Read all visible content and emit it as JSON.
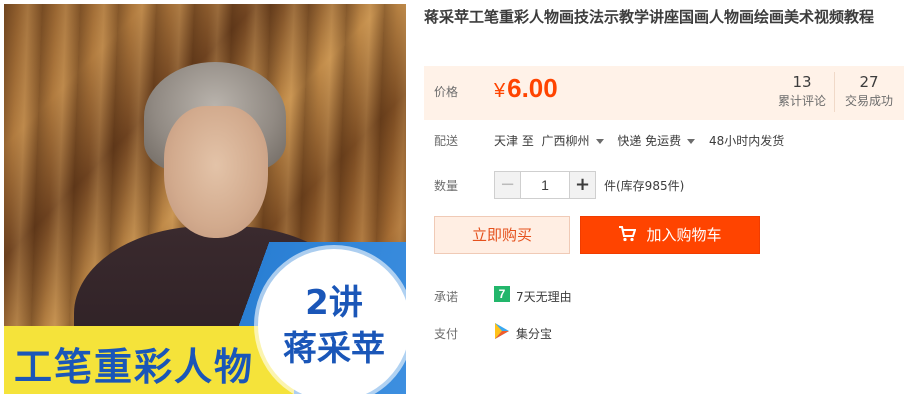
{
  "product": {
    "image": {
      "banner_title": "工笔重彩人物",
      "circle_line1": "2讲",
      "circle_line2": "蒋采苹"
    },
    "title": "蒋采苹工笔重彩人物画技法示教学讲座国画人物画绘画美术视频教程",
    "price": {
      "label": "价格",
      "currency": "¥",
      "value": "6.00"
    },
    "stats": [
      {
        "num": "13",
        "label": "累计评论"
      },
      {
        "num": "27",
        "label": "交易成功"
      }
    ],
    "shipping": {
      "label": "配送",
      "from": "天津",
      "to_word": "至",
      "destination": "广西柳州",
      "method": "快递 免运费",
      "dispatch": "48小时内发货"
    },
    "quantity": {
      "label": "数量",
      "value": "1",
      "minus": "−",
      "plus": "+",
      "stock": "件(库存985件)"
    },
    "buttons": {
      "buy_now": "立即购买",
      "add_cart": "加入购物车"
    },
    "promise": {
      "label": "承诺",
      "badge": "7",
      "text": "7天无理由"
    },
    "payment": {
      "label": "支付",
      "text": "集分宝"
    }
  },
  "colors": {
    "accent": "#ff4400",
    "price_bg": "#fff2e8",
    "buy_bg": "#ffeee3",
    "promise_green": "#22b66b"
  }
}
